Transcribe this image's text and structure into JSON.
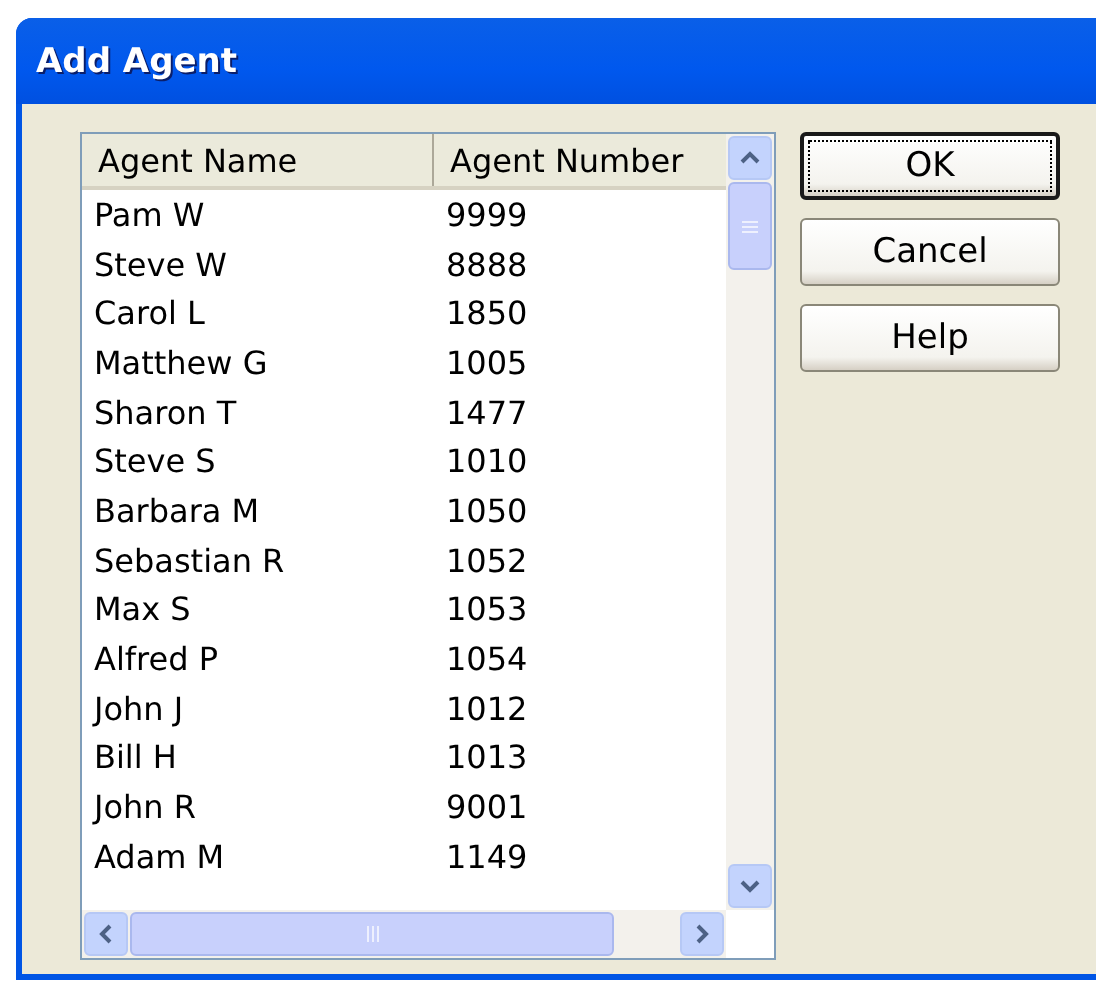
{
  "window": {
    "title": "Add Agent"
  },
  "list": {
    "columns": [
      "Agent Name",
      "Agent Number"
    ],
    "rows": [
      {
        "name": "Pam W",
        "number": "9999"
      },
      {
        "name": "Steve W",
        "number": "8888"
      },
      {
        "name": "Carol L",
        "number": "1850"
      },
      {
        "name": "Matthew G",
        "number": "1005"
      },
      {
        "name": "Sharon T",
        "number": "1477"
      },
      {
        "name": "Steve S",
        "number": "1010"
      },
      {
        "name": "Barbara M",
        "number": "1050"
      },
      {
        "name": "Sebastian R",
        "number": "1052"
      },
      {
        "name": "Max S",
        "number": "1053"
      },
      {
        "name": "Alfred P",
        "number": "1054"
      },
      {
        "name": "John J",
        "number": "1012"
      },
      {
        "name": "Bill H",
        "number": "1013"
      },
      {
        "name": "John R",
        "number": "9001"
      },
      {
        "name": "Adam M",
        "number": "1149"
      }
    ]
  },
  "buttons": [
    {
      "label": "OK",
      "default": true
    },
    {
      "label": "Cancel",
      "default": false
    },
    {
      "label": "Help",
      "default": false
    }
  ]
}
